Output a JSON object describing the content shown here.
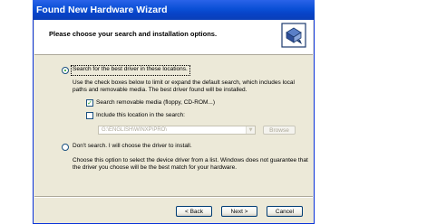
{
  "window": {
    "title": "Found New Hardware Wizard",
    "accent": "#0a4fd6"
  },
  "header": {
    "title": "Please choose your search and installation options.",
    "icon": "hardware-wizard-icon"
  },
  "options": {
    "search_best": {
      "label": "Search for the best driver in these locations.",
      "selected": true,
      "description_line1": "Use the check boxes below to limit or expand the default search, which includes local",
      "description_line2": "paths and removable media. The best driver found will be installed."
    },
    "search_removable": {
      "label": "Search removable media (floppy, CD-ROM...)",
      "checked": true
    },
    "include_location": {
      "label": "Include this location in the search:",
      "checked": false,
      "path": "G:\\ENGLISH\\WINXP\\PRO\\",
      "browse_label": "Browse"
    },
    "dont_search": {
      "label": "Don't search. I will choose the driver to install.",
      "selected": false,
      "description_line1": "Choose this option to select the device driver from a list.  Windows does not guarantee that",
      "description_line2": "the driver you choose will be the best match for your hardware."
    }
  },
  "footer": {
    "back_label": "< Back",
    "next_label": "Next >",
    "cancel_label": "Cancel"
  }
}
